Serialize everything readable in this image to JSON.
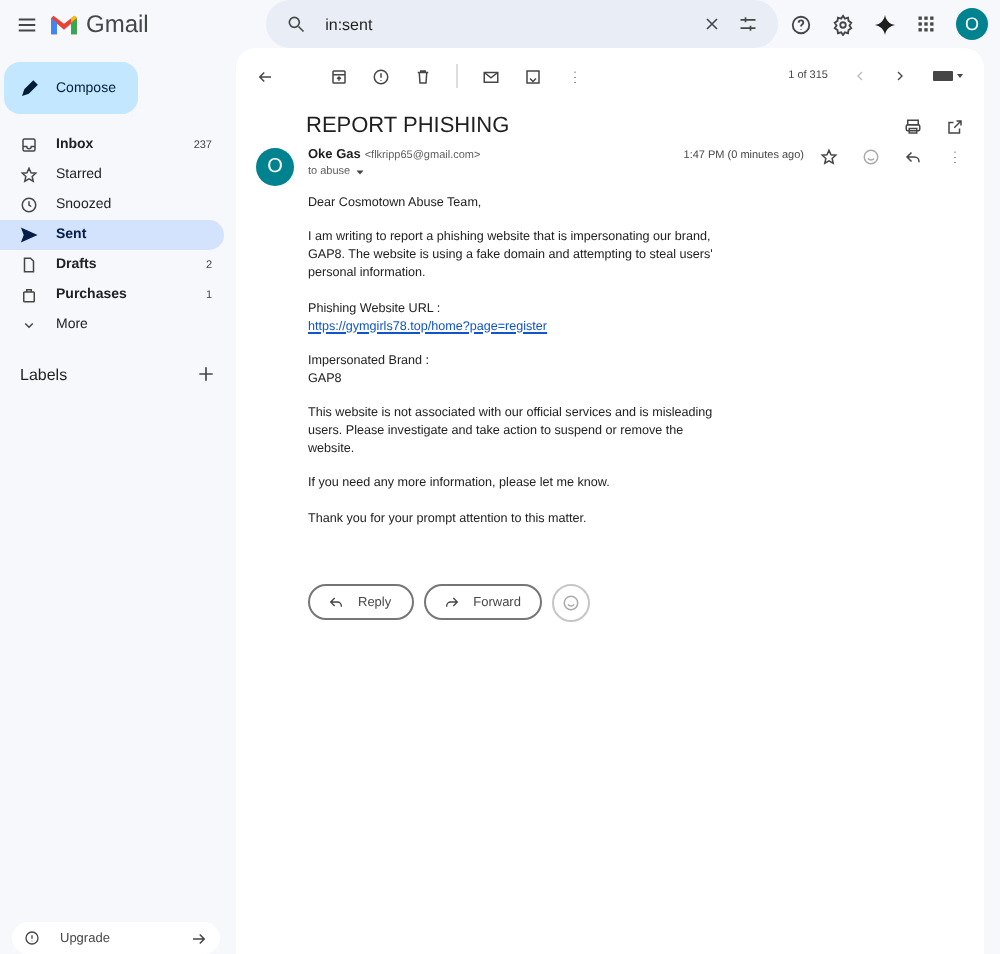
{
  "header": {
    "app_name": "Gmail",
    "search": {
      "value": "in:sent"
    },
    "account_initial": "O"
  },
  "compose": "Compose",
  "sidebar": {
    "items": [
      {
        "label": "Inbox",
        "count": "237",
        "selected": false,
        "bold": true
      },
      {
        "label": "Starred",
        "selected": false,
        "bold": false
      },
      {
        "label": "Snoozed",
        "selected": false,
        "bold": false
      },
      {
        "label": "Sent",
        "selected": true,
        "bold": true
      },
      {
        "label": "Drafts",
        "count": "2",
        "selected": false,
        "bold": true
      },
      {
        "label": "Purchases",
        "count": "1",
        "selected": false,
        "bold": true
      },
      {
        "label": "More",
        "selected": false,
        "bold": false
      }
    ],
    "labels_heading": "Labels",
    "upgrade": "Upgrade"
  },
  "toolbar": {
    "pager": "1 of 315"
  },
  "message": {
    "subject": "REPORT PHISHING",
    "sender_initial": "O",
    "sender_name": "Oke Gas",
    "sender_email": "<flkripp65@gmail.com>",
    "recipient": "to abuse",
    "time": "1:47 PM (0 minutes ago)",
    "body": [
      {
        "kind": "text",
        "lines": [
          "Dear Cosmotown Abuse Team,"
        ]
      },
      {
        "kind": "text",
        "lines": [
          "I am writing to report a phishing website that is impersonating our brand, GAP8. The website is using a fake domain and attempting to steal users' personal information."
        ]
      },
      {
        "kind": "link",
        "lines": [
          "Phishing Website URL :",
          "https://gymgirls78.top/home?page=register"
        ]
      },
      {
        "kind": "text",
        "lines": [
          "Impersonated Brand :",
          "GAP8"
        ]
      },
      {
        "kind": "text",
        "lines": [
          "This website is not associated with our official services and is misleading users. Please investigate and take action to suspend or remove the website."
        ]
      },
      {
        "kind": "text",
        "lines": [
          "If you need any more information, please let me know."
        ]
      },
      {
        "kind": "text",
        "lines": [
          "Thank you for your prompt attention to this matter."
        ]
      }
    ]
  },
  "actions": [
    "Reply",
    "Forward"
  ]
}
